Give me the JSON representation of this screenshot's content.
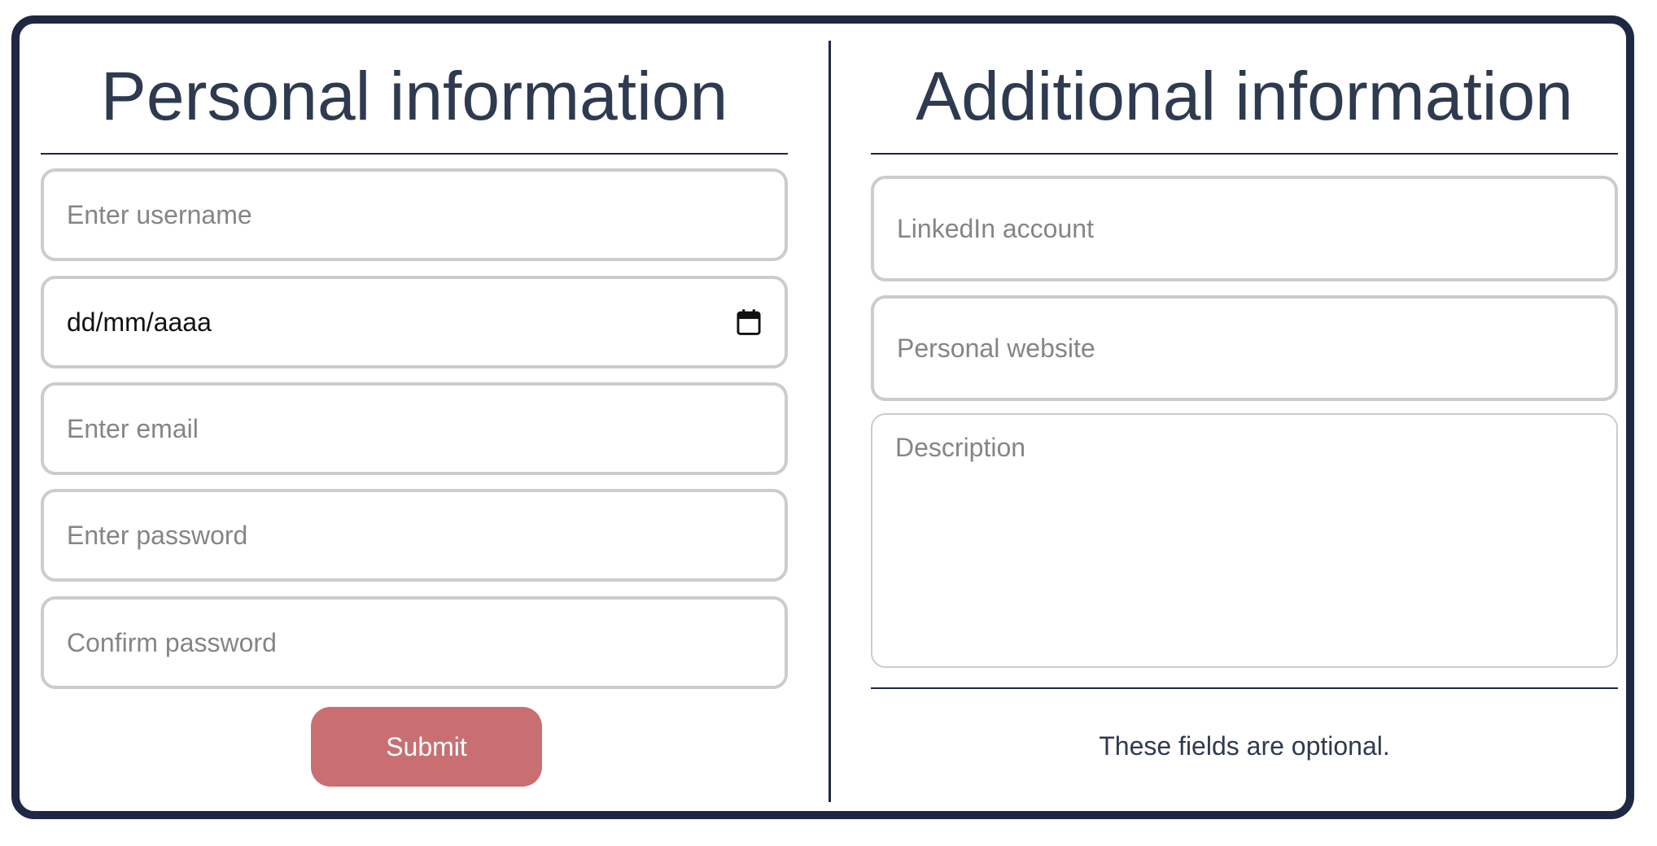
{
  "personal": {
    "title": "Personal information",
    "username_placeholder": "Enter username",
    "date_format": "dd/mm/aaaa",
    "calendar_icon": "calendar-icon",
    "email_placeholder": "Enter email",
    "password_placeholder": "Enter password",
    "confirm_placeholder": "Confirm password",
    "submit_label": "Submit"
  },
  "additional": {
    "title": "Additional information",
    "linkedin_placeholder": "LinkedIn account",
    "website_placeholder": "Personal website",
    "description_placeholder": "Description",
    "note": "These fields are optional."
  },
  "colors": {
    "frame": "#1f2843",
    "heading_text": "#2e3a50",
    "field_border": "#cccccc",
    "placeholder": "#858585",
    "submit_bg": "#c96f72",
    "submit_text": "#ffffff"
  }
}
